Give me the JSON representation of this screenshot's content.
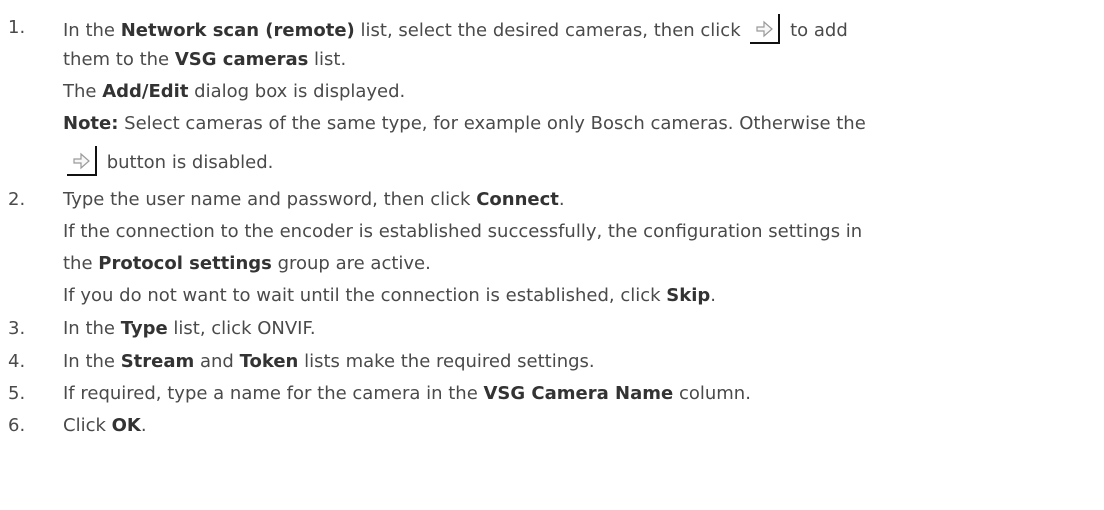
{
  "steps": [
    {
      "number": "1.",
      "lines": {
        "l1a": "In the ",
        "l1b": "Network scan (remote)",
        "l1c": " list, select the desired cameras, then click ",
        "l1d": " to add",
        "l2a": "them to the ",
        "l2b": "VSG cameras",
        "l2c": " list.",
        "l3a": "The ",
        "l3b": "Add/Edit",
        "l3c": " dialog box is displayed.",
        "l4a": "Note:",
        "l4b": " Select cameras of the same type, for example only Bosch cameras. Otherwise the",
        "l5a": " button is disabled."
      }
    },
    {
      "number": "2.",
      "lines": {
        "l1a": "Type the user name and password, then click ",
        "l1b": "Connect",
        "l1c": ".",
        "l2a": "If the connection to the encoder is established successfully, the configuration settings in",
        "l3a": "the ",
        "l3b": "Protocol settings",
        "l3c": " group are active.",
        "l4a": "If you do not want to wait until the connection is established, click ",
        "l4b": "Skip",
        "l4c": "."
      }
    },
    {
      "number": "3.",
      "lines": {
        "l1a": "In the ",
        "l1b": "Type",
        "l1c": " list, click ONVIF."
      }
    },
    {
      "number": "4.",
      "lines": {
        "l1a": "In the ",
        "l1b": "Stream",
        "l1c": " and ",
        "l1d": "Token",
        "l1e": " lists make the required settings."
      }
    },
    {
      "number": "5.",
      "lines": {
        "l1a": "If required, type a name for the camera in the ",
        "l1b": "VSG Camera Name",
        "l1c": " column."
      }
    },
    {
      "number": "6.",
      "lines": {
        "l1a": "Click ",
        "l1b": "OK",
        "l1c": "."
      }
    }
  ],
  "icons": {
    "add_button": "right-arrow-icon"
  }
}
